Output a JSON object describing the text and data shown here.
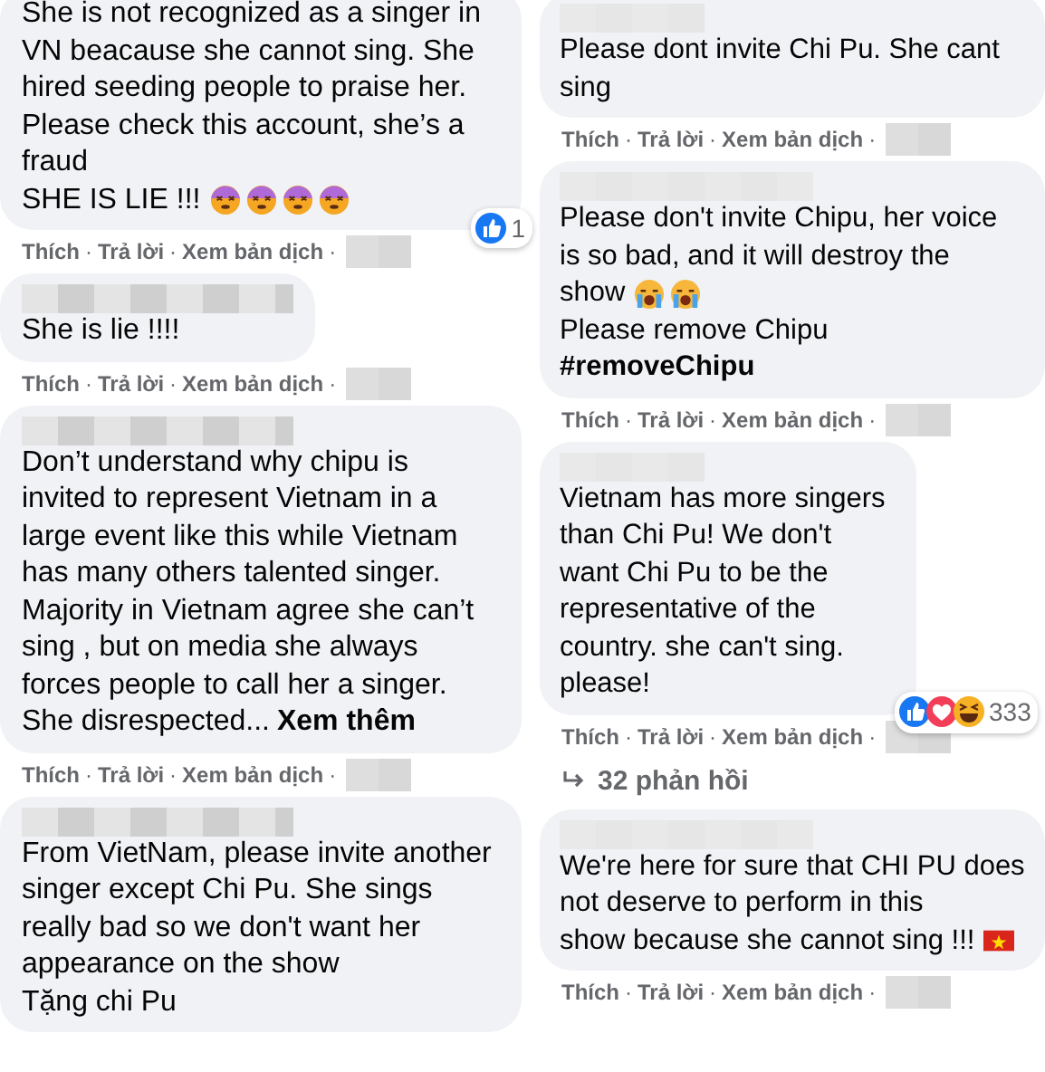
{
  "separator": "·",
  "columns": [
    {
      "comments": [
        {
          "paragraphs": [
            {
              "text": "She is not recognized as a singer in VN beacause she cannot sing. She hired seeding people to praise her. Please check this account, she’s a fraud"
            },
            {
              "text": "SHE IS LIE !!!",
              "emoji": [
                {
                  "kind": "dizzy"
                },
                {
                  "kind": "dizzy"
                },
                {
                  "kind": "dizzy"
                },
                {
                  "kind": "dizzy"
                }
              ]
            }
          ],
          "reactions": {
            "icons": [
              {
                "kind": "like"
              }
            ],
            "count": "1"
          },
          "actions": [
            "Thích",
            "Trả lời",
            "Xem bản dịch"
          ]
        },
        {
          "name_hidden": true,
          "paragraphs": [
            {
              "text": "She is lie !!!!"
            }
          ],
          "actions": [
            "Thích",
            "Trả lời",
            "Xem bản dịch"
          ]
        },
        {
          "name_hidden": true,
          "paragraphs": [
            {
              "text": "Don’t understand why chipu is invited to represent Vietnam in a large event like this while Vietnam has many others talented singer. Majority in Vietnam agree she can’t sing , but on media she always forces people to call her a singer. She disrespected..."
            }
          ],
          "see_more": "Xem thêm",
          "actions": [
            "Thích",
            "Trả lời",
            "Xem bản dịch"
          ]
        },
        {
          "name_hidden": true,
          "paragraphs": [
            {
              "text": "From VietNam, please invite another singer except Chi Pu. She sings really bad so we don't want her appearance on the show"
            },
            {
              "text": "Tặng chi Pu"
            }
          ]
        }
      ]
    },
    {
      "comments": [
        {
          "name_hidden": true,
          "paragraphs": [
            {
              "text": "Please dont invite Chi Pu. She cant sing"
            }
          ],
          "actions": [
            "Thích",
            "Trả lời",
            "Xem bản dịch"
          ]
        },
        {
          "name_hidden": true,
          "paragraphs": [
            {
              "text": "Please don't invite Chipu, her voice is so bad, and it will destroy the"
            },
            {
              "text": "show",
              "emoji": [
                {
                  "kind": "crying"
                },
                {
                  "kind": "crying"
                }
              ]
            },
            {
              "text": "Please remove Chipu"
            },
            {
              "text": "**#removeChipu**"
            }
          ],
          "actions": [
            "Thích",
            "Trả lời",
            "Xem bản dịch"
          ]
        },
        {
          "name_hidden": true,
          "paragraphs": [
            {
              "text": "Vietnam has more singers than Chi Pu! We don't want Chi Pu to be the representative of the country. she can't sing. please!"
            }
          ],
          "reactions": {
            "icons": [
              {
                "kind": "like"
              },
              {
                "kind": "love"
              },
              {
                "kind": "haha"
              }
            ],
            "count": "333"
          },
          "actions": [
            "Thích",
            "Trả lời",
            "Xem bản dịch"
          ],
          "replies": "32 phản hồi"
        },
        {
          "name_hidden": true,
          "paragraphs": [
            {
              "text": "We're here for sure that CHI PU does not deserve to perform in this"
            },
            {
              "text": "show because she cannot sing !!!",
              "emoji": [
                {
                  "kind": "flag"
                }
              ]
            }
          ],
          "actions": [
            "Thích",
            "Trả lời",
            "Xem bản dịch"
          ]
        }
      ]
    }
  ]
}
